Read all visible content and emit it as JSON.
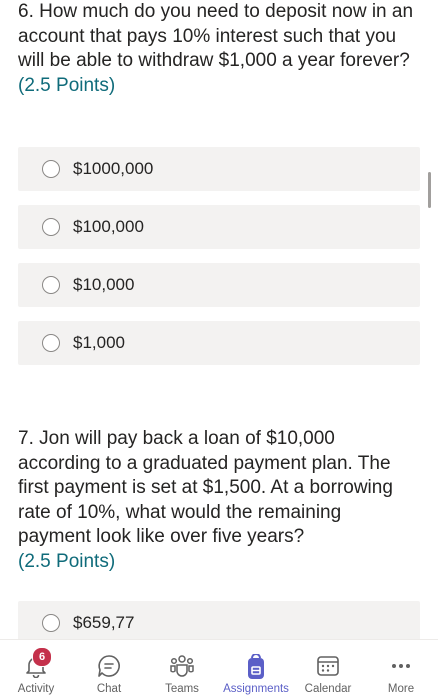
{
  "questions": [
    {
      "text": "6. How much do you need to deposit now in an account that pays 10% interest such that you will be able to withdraw $1,000 a year forever?",
      "points": "(2.5 Points)",
      "options": [
        "$1000,000",
        "$100,000",
        "$10,000",
        "$1,000"
      ]
    },
    {
      "text": "7. Jon will pay back a loan of $10,000 according to a graduated payment plan. The first payment is set at $1,500. At a borrowing rate of 10%, what would the remaining payment look like over five years?",
      "points": "(2.5 Points)",
      "options": [
        "$659,77"
      ]
    }
  ],
  "tabbar": {
    "items": [
      {
        "label": "Activity",
        "icon": "bell-icon",
        "badge": "6"
      },
      {
        "label": "Chat",
        "icon": "chat-icon"
      },
      {
        "label": "Teams",
        "icon": "teams-icon"
      },
      {
        "label": "Assignments",
        "icon": "assignments-icon",
        "active": true
      },
      {
        "label": "Calendar",
        "icon": "calendar-icon"
      },
      {
        "label": "More",
        "icon": "more-icon"
      }
    ]
  },
  "colors": {
    "accent": "#5b5fc7",
    "points_text": "#0f6b7a",
    "option_bg": "#f3f2f1",
    "badge": "#c4314b"
  }
}
